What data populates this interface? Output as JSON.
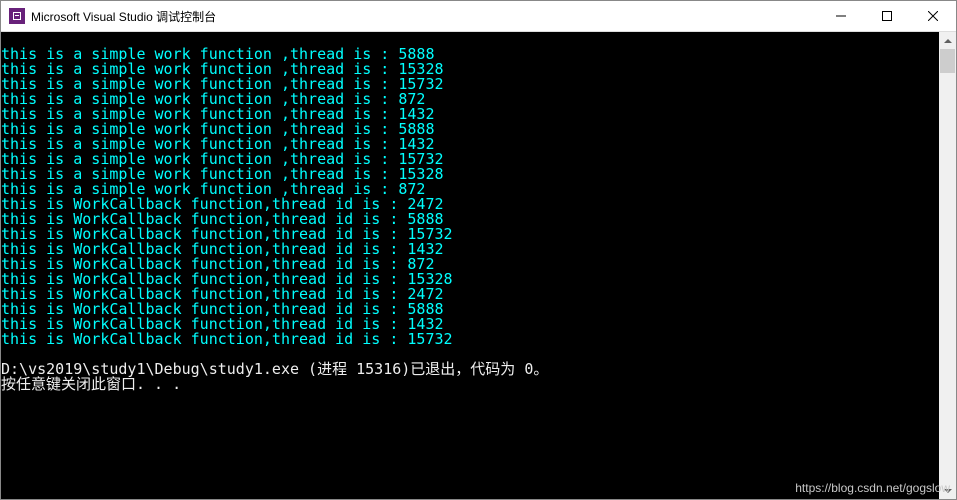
{
  "window": {
    "title": "Microsoft Visual Studio 调试控制台"
  },
  "console": {
    "simple_prefix": "this is a simple work function ,thread is : ",
    "simple_ids": [
      "5888",
      "15328",
      "15732",
      "872",
      "1432",
      "5888",
      "1432",
      "15732",
      "15328",
      "872"
    ],
    "cb_prefix": "this is WorkCallback function,thread id is : ",
    "cb_ids": [
      "2472",
      "5888",
      "15732",
      "1432",
      "872",
      "15328",
      "2472",
      "5888",
      "1432",
      "15732"
    ],
    "blank": "",
    "exit_line": "D:\\vs2019\\study1\\Debug\\study1.exe (进程 15316)已退出，代码为 0。",
    "press_key": "按任意键关闭此窗口. . ."
  },
  "watermark": "https://blog.csdn.net/gogslow"
}
